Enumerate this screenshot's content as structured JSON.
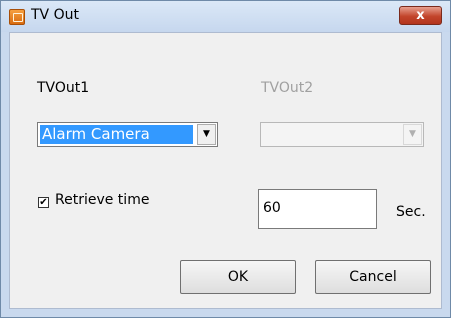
{
  "window": {
    "title": "TV Out",
    "close_label": "x"
  },
  "tvout1": {
    "label": "TVOut1",
    "selected": "Alarm Camera",
    "dropdown_arrow": "▼"
  },
  "tvout2": {
    "label": "TVOut2",
    "selected": "",
    "dropdown_arrow": "▼",
    "enabled": false
  },
  "retrieve": {
    "checkbox_checked": true,
    "check_mark": "✔",
    "label": "Retrieve time",
    "value": "60",
    "unit": "Sec."
  },
  "buttons": {
    "ok": "OK",
    "cancel": "Cancel"
  },
  "colors": {
    "selection": "#3399ff",
    "close_button": "#c2452b",
    "title_bar": "#c6d7ee"
  },
  "icons": {
    "app": "app-icon",
    "close": "close-icon"
  }
}
